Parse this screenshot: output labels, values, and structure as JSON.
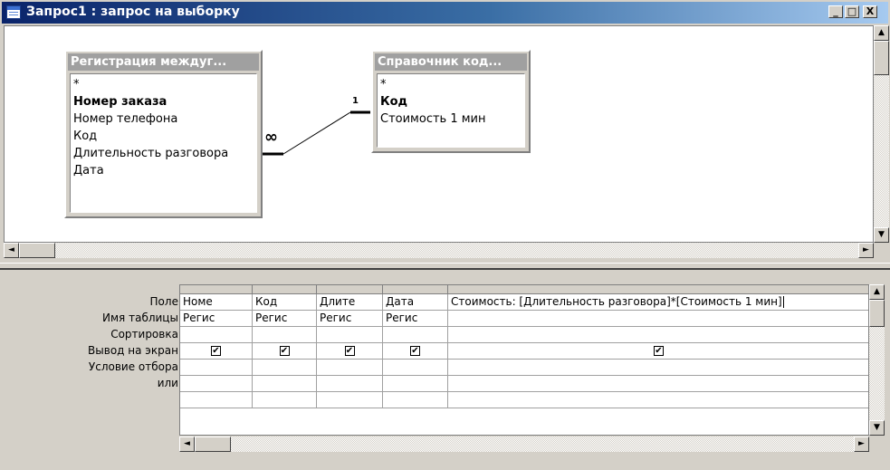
{
  "window": {
    "title": "Запрос1 : запрос на выборку",
    "buttons": {
      "minimize": "_",
      "maximize": "□",
      "close": "X"
    }
  },
  "tables": [
    {
      "title": "Регистрация междуг...",
      "fields": [
        {
          "name": "*",
          "key": false
        },
        {
          "name": "Номер заказа",
          "key": true
        },
        {
          "name": "Номер телефона",
          "key": false
        },
        {
          "name": "Код",
          "key": false
        },
        {
          "name": "Длительность разговора",
          "key": false
        },
        {
          "name": "Дата",
          "key": false
        }
      ]
    },
    {
      "title": "Справочник код...",
      "fields": [
        {
          "name": "*",
          "key": false
        },
        {
          "name": "Код",
          "key": true
        },
        {
          "name": "Стоимость 1 мин",
          "key": false
        }
      ]
    }
  ],
  "relationship": {
    "many_label": "∞",
    "one_label": "1"
  },
  "grid": {
    "row_labels": [
      "Поле:",
      "Имя таблицы:",
      "Сортировка:",
      "Вывод на экран:",
      "Условие отбора:",
      "или:"
    ],
    "columns": [
      {
        "field": "Номе",
        "table": "Регис",
        "sort": "",
        "show": true
      },
      {
        "field": "Код",
        "table": "Регис",
        "sort": "",
        "show": true
      },
      {
        "field": "Длите",
        "table": "Регис",
        "sort": "",
        "show": true
      },
      {
        "field": "Дата",
        "table": "Регис",
        "sort": "",
        "show": true
      },
      {
        "field": "Стоимость: [Длительность разговора]*[Стоимость 1 мин]",
        "table": "",
        "sort": "",
        "show": true
      }
    ]
  },
  "scroll_arrows": {
    "up": "▲",
    "down": "▼",
    "left": "◄",
    "right": "►"
  },
  "checkmark": "✔"
}
